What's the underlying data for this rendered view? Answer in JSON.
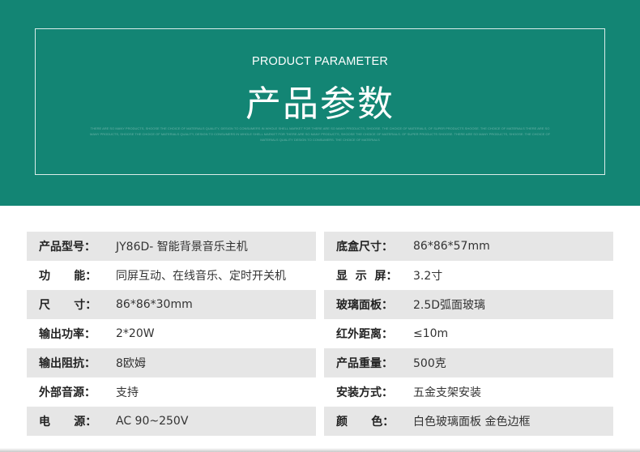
{
  "banner": {
    "title_en": "PRODUCT PARAMETER",
    "title_cn": "产品参数",
    "fine_print": "THERE ARE SO MANY PRODUCTS, SHOOSE THE CHOICE OF MATERIALS QUALITY, DESIGN TO CONSUMERS IN WHOLE SHELL MARKET FOR THERE ARE SO MANY PRODUCTS, SHOOSE. THE CHOICE OF MATERIALS, OF SUPER PRODUCTS SHOOSE. THE CHOICE OF MATERIALS THERE ARE SO MANY PRODUCTS, SHOOSE THE CHOICE OF MATERIALS QUALITY, DESIGN TO CONSUMERS IN WHOLE SHELL MARKET FOR THERE ARE SO MANY PRODUCTS, SHOOSE THE CHOICE OF MATERIALS. OF SUPER PRODUCTS SHOOSE. THERE ARE SO MANY PRODUCTS, SHOOSE. THE CHOICE OF MATERIALS QUALITY DESIGN TO CONSUMERS. THE CHOICE OF MATERIALS"
  },
  "params_left": [
    {
      "label": "产品型号：",
      "value": "JY86D- 智能背景音乐主机"
    },
    {
      "label": "功      能：",
      "value": "同屏互动、在线音乐、定时开关机"
    },
    {
      "label": "尺      寸：",
      "value": "86*86*30mm"
    },
    {
      "label": "输出功率：",
      "value": "2*20W"
    },
    {
      "label": "输出阻抗：",
      "value": "8欧姆"
    },
    {
      "label": "外部音源：",
      "value": "支持"
    },
    {
      "label": "电      源：",
      "value": "AC 90~250V"
    }
  ],
  "params_right": [
    {
      "label": "底盒尺寸：",
      "value": "86*86*57mm"
    },
    {
      "label": "显  示  屏：",
      "value": "3.2寸"
    },
    {
      "label": "玻璃面板：",
      "value": "2.5D弧面玻璃"
    },
    {
      "label": "红外距离：",
      "value": "≤10m"
    },
    {
      "label": "产品重量：",
      "value": "500克"
    },
    {
      "label": "安装方式：",
      "value": "五金支架安装"
    },
    {
      "label": "颜      色：",
      "value": "白色玻璃面板  金色边框"
    }
  ],
  "colors": {
    "banner_bg": "#138574",
    "row_shade": "#e6e6e6"
  }
}
